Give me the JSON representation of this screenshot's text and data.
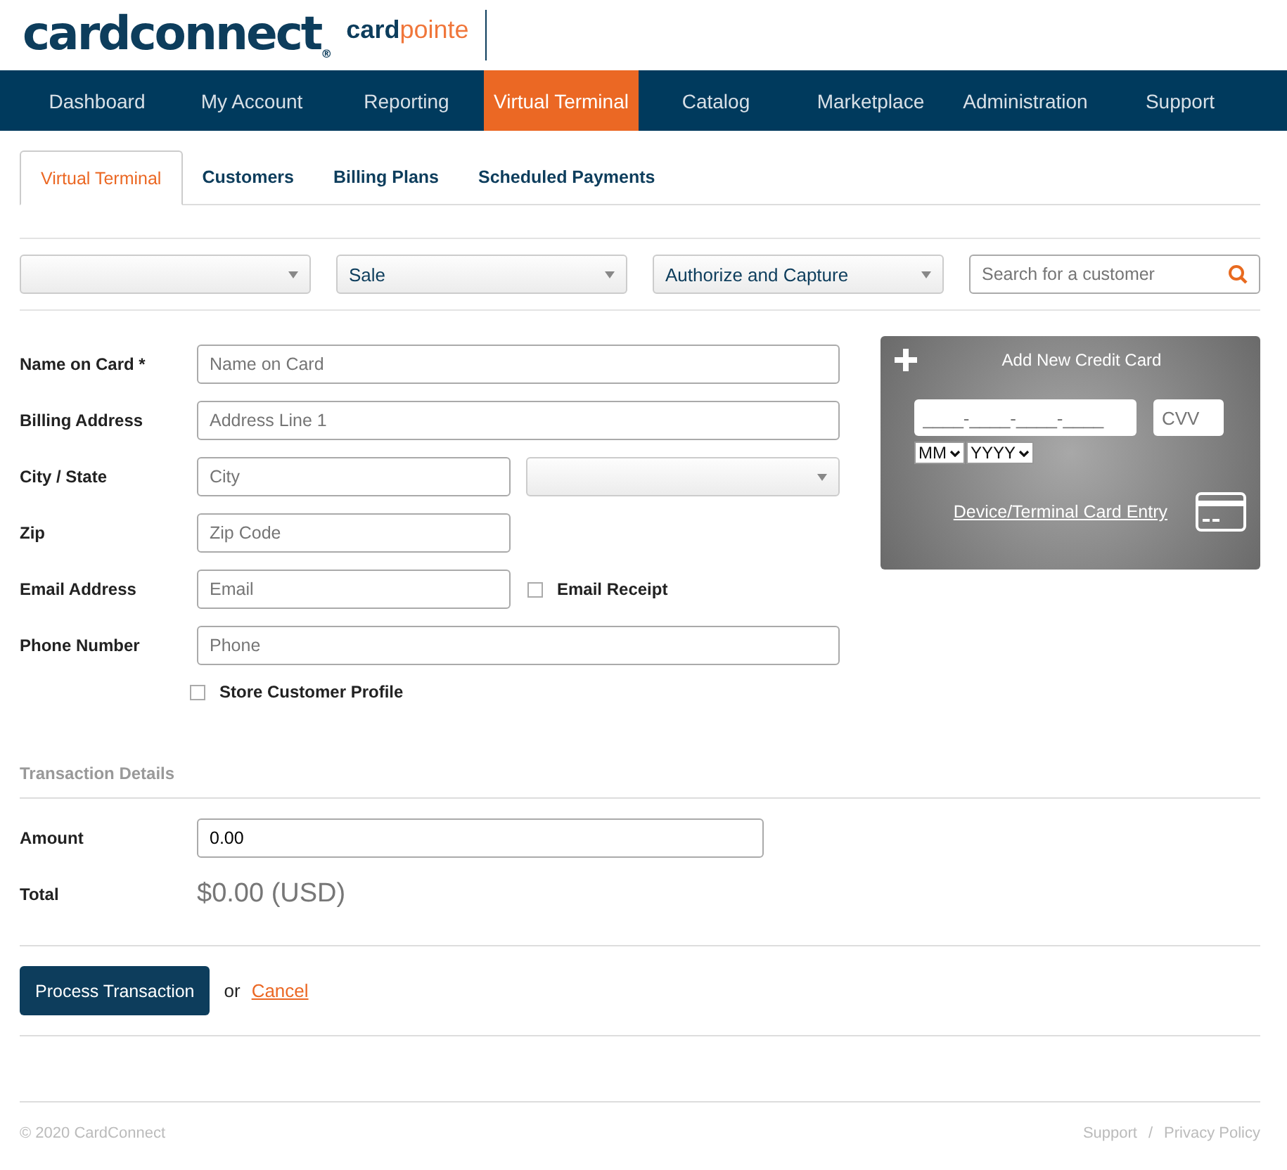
{
  "logo": {
    "brand": "cardconnect",
    "mark": "®",
    "product_prefix": "card",
    "product_suffix": "pointe"
  },
  "nav": [
    {
      "label": "Dashboard",
      "selected": false
    },
    {
      "label": "My Account",
      "selected": false
    },
    {
      "label": "Reporting",
      "selected": false
    },
    {
      "label": "Virtual Terminal",
      "selected": true
    },
    {
      "label": "Catalog",
      "selected": false
    },
    {
      "label": "Marketplace",
      "selected": false
    },
    {
      "label": "Administration",
      "selected": false
    },
    {
      "label": "Support",
      "selected": false
    }
  ],
  "tabs": [
    {
      "label": "Virtual Terminal",
      "selected": true
    },
    {
      "label": "Customers",
      "selected": false
    },
    {
      "label": "Billing Plans",
      "selected": false
    },
    {
      "label": "Scheduled Payments",
      "selected": false
    }
  ],
  "filters": [
    {
      "kind": "dropdown"
    },
    {
      "kind": "dropdown",
      "value": "Sale"
    },
    {
      "kind": "dropdown",
      "value": "Authorize and Capture"
    }
  ],
  "customer_search": {
    "placeholder": "Search for a customer"
  },
  "form": [
    {
      "label": "Name on Card *",
      "kind": "text",
      "placeholder": "Name on Card"
    },
    {
      "label": "Billing Address",
      "kind": "text",
      "placeholder": "Address Line 1"
    },
    {
      "label": "City / State",
      "kind": "city",
      "placeholder": "City"
    },
    {
      "label": "Zip",
      "kind": "short",
      "placeholder": "Zip Code"
    },
    {
      "label": "Email Address",
      "kind": "email",
      "placeholder": "Email",
      "check_label": "Email Receipt",
      "checked": false
    },
    {
      "label": "Phone Number",
      "kind": "text",
      "placeholder": "Phone"
    }
  ],
  "store_profile": {
    "label": "Store Customer Profile",
    "checked": false
  },
  "card": {
    "title": "Add New Credit Card",
    "number_placeholder": "____-____-____-____",
    "cvv_placeholder": "CVV",
    "month": "MM",
    "year": "YYYY",
    "device_link": "Device/Terminal Card Entry"
  },
  "transaction": {
    "heading": "Transaction Details",
    "amount_label": "Amount",
    "amount": "0.00",
    "total_label": "Total",
    "total": "$0.00 (USD)"
  },
  "actions": {
    "submit": "Process Transaction",
    "or": "or",
    "cancel": "Cancel"
  },
  "footer": {
    "copyright": "© 2020 CardConnect",
    "links": [
      "Support",
      "Privacy Policy"
    ],
    "separator": "/"
  }
}
